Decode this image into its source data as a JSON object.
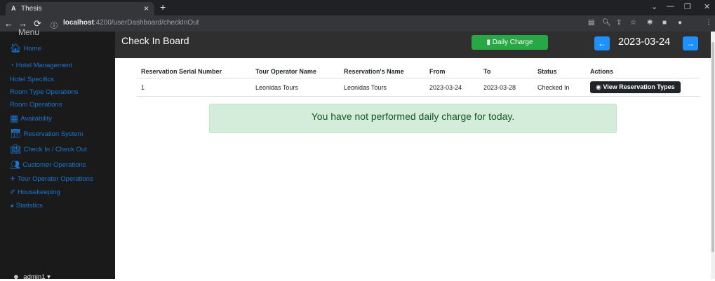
{
  "browser": {
    "tab_title": "Thesis",
    "tab_favicon": "A",
    "url_host": "localhost",
    "url_rest": ":4200/userDashboard/checkInOut"
  },
  "sidebar": {
    "menu_label": "Menu",
    "items": [
      {
        "label": "Home",
        "icon": "home-icon"
      },
      {
        "label": "Hotel Management",
        "icon": "dashboard-icon"
      },
      {
        "label": "Hotel Specifics",
        "icon": ""
      },
      {
        "label": "Room Type Operations",
        "icon": ""
      },
      {
        "label": "Room Operations",
        "icon": ""
      },
      {
        "label": "Availability",
        "icon": "table-icon"
      },
      {
        "label": "Reservation System",
        "icon": "calendar-icon"
      },
      {
        "label": "Check In / Check Out",
        "icon": "hotel-icon"
      },
      {
        "label": "Customer Operations",
        "icon": "users-icon"
      },
      {
        "label": "Tour Operator Operations",
        "icon": "plane-icon"
      },
      {
        "label": "Housekeeping",
        "icon": "broom-icon"
      },
      {
        "label": "Statistics",
        "icon": "chart-icon"
      }
    ],
    "user": "admin1"
  },
  "header": {
    "title": "Check In Board",
    "daily_charge_label": "Daily Charge",
    "date": "2023-03-24"
  },
  "table": {
    "columns": [
      "Reservation Serial Number",
      "Tour Operator Name",
      "Reservation's Name",
      "From",
      "To",
      "Status",
      "Actions"
    ],
    "rows": [
      {
        "serial": "1",
        "operator": "Leonidas Tours",
        "name": "Leonidas Tours",
        "from": "2023-03-24",
        "to": "2023-03-28",
        "status": "Checked In",
        "action": "View Reservation Types"
      }
    ]
  },
  "alert": {
    "message": "You have not performed daily charge for today."
  },
  "colors": {
    "sidebar_bg": "#1a1a1a",
    "link_blue": "#1976d2",
    "success_green": "#28a745",
    "date_blue": "#1e90ff"
  }
}
